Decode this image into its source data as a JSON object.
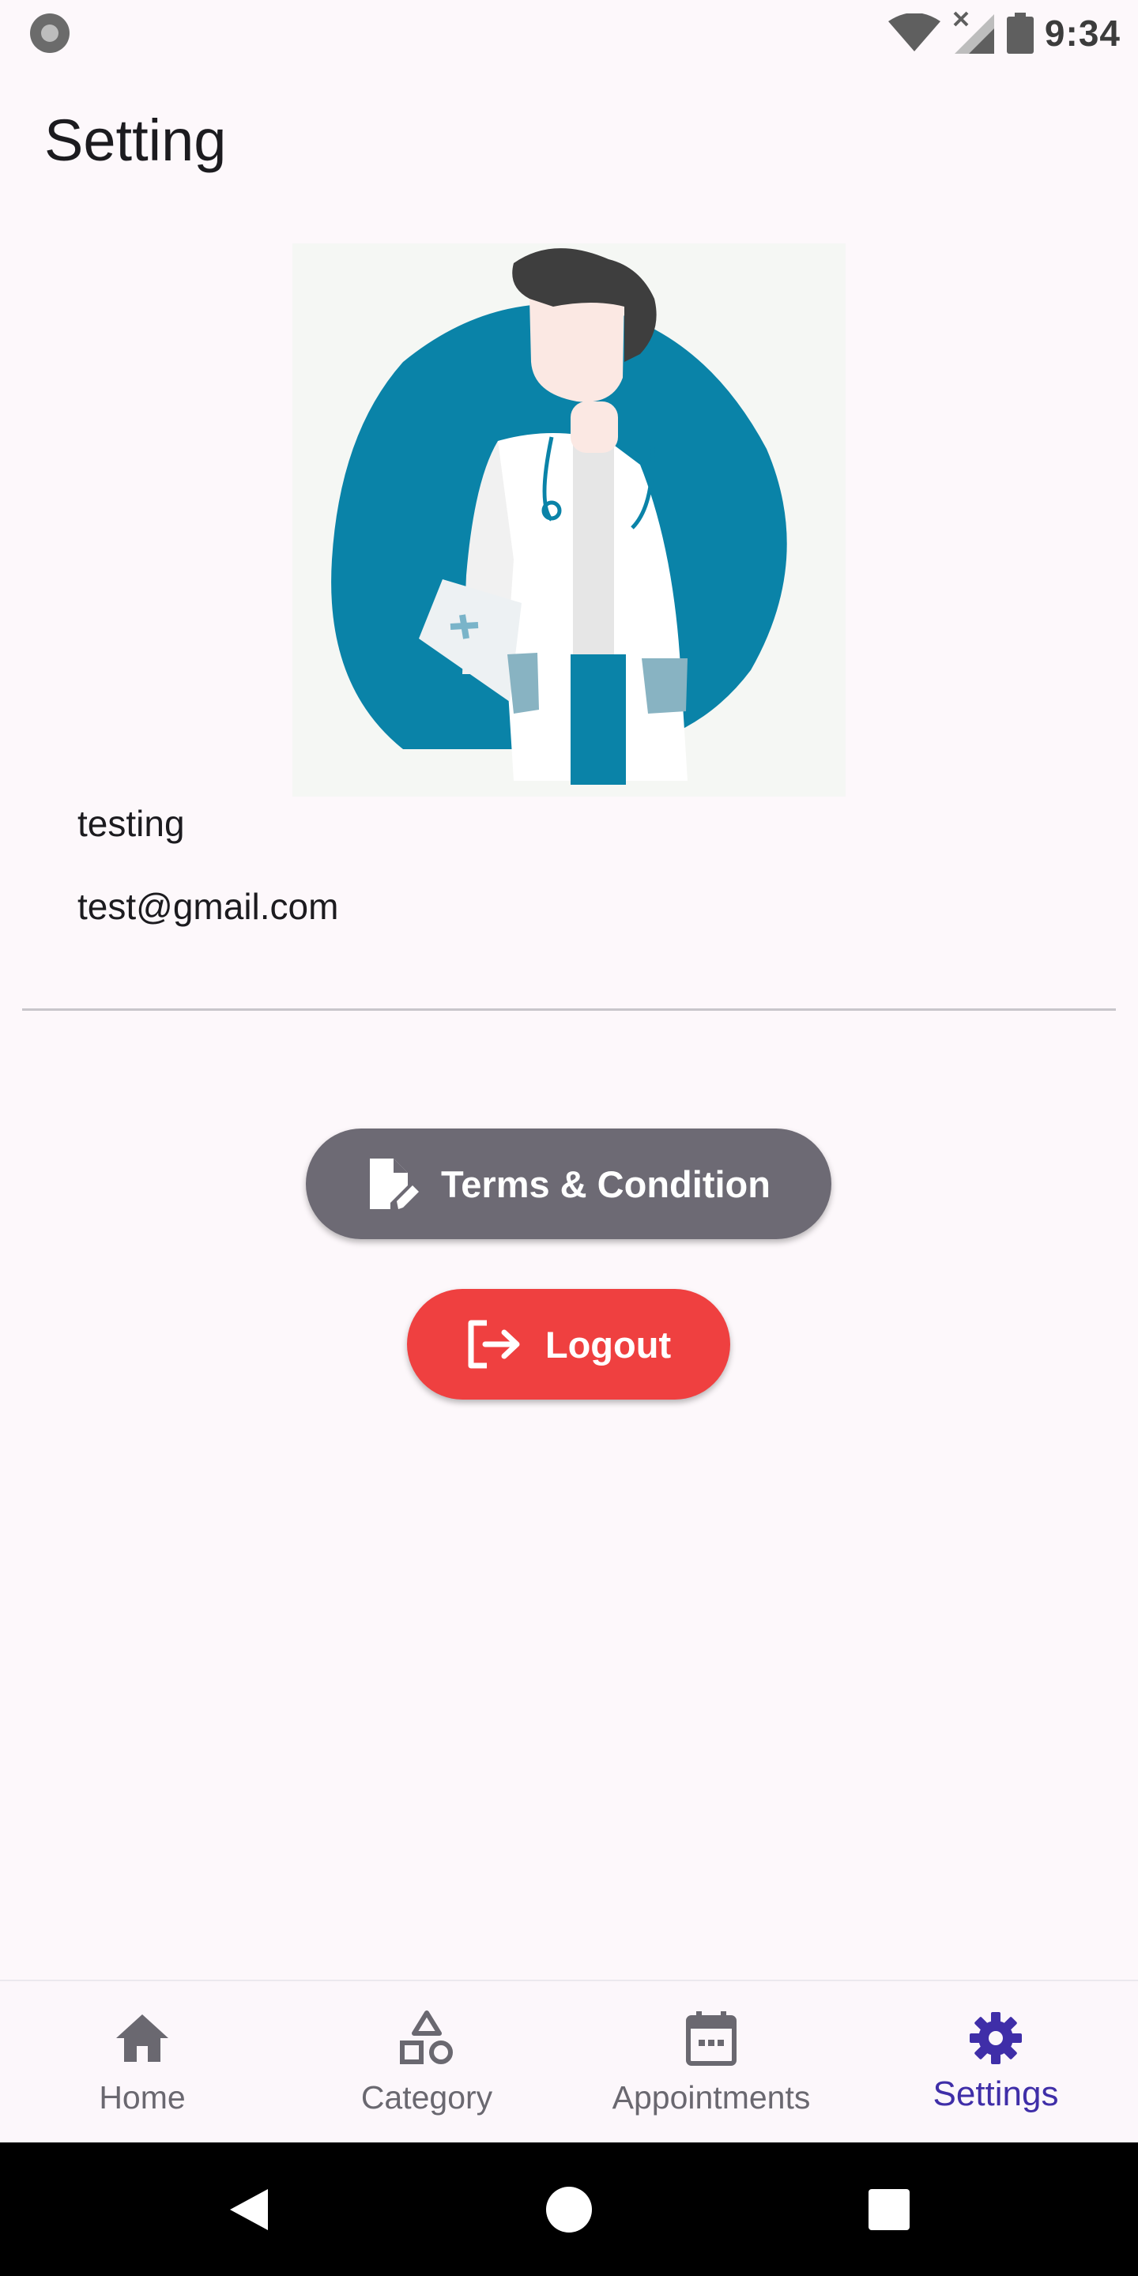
{
  "status_bar": {
    "time": "9:34",
    "icons": [
      "record-indicator-icon",
      "wifi-icon",
      "cellular-no-signal-icon",
      "battery-icon"
    ]
  },
  "header": {
    "title": "Setting"
  },
  "profile": {
    "image": "doctor-illustration",
    "name": "testing",
    "email": "test@gmail.com"
  },
  "actions": {
    "terms": {
      "label": "Terms & Condition",
      "icon": "document-edit-icon",
      "color": "#6d6a74"
    },
    "logout": {
      "label": "Logout",
      "icon": "logout-icon",
      "color": "#ef4040"
    }
  },
  "bottom_nav": {
    "items": [
      {
        "label": "Home",
        "icon": "home-icon",
        "active": false
      },
      {
        "label": "Category",
        "icon": "shapes-icon",
        "active": false
      },
      {
        "label": "Appointments",
        "icon": "calendar-icon",
        "active": false
      },
      {
        "label": "Settings",
        "icon": "gear-icon",
        "active": true
      }
    ],
    "active_color": "#3f2ea8"
  },
  "system_nav": {
    "buttons": [
      "back-icon",
      "home-circle-icon",
      "recents-icon"
    ]
  }
}
